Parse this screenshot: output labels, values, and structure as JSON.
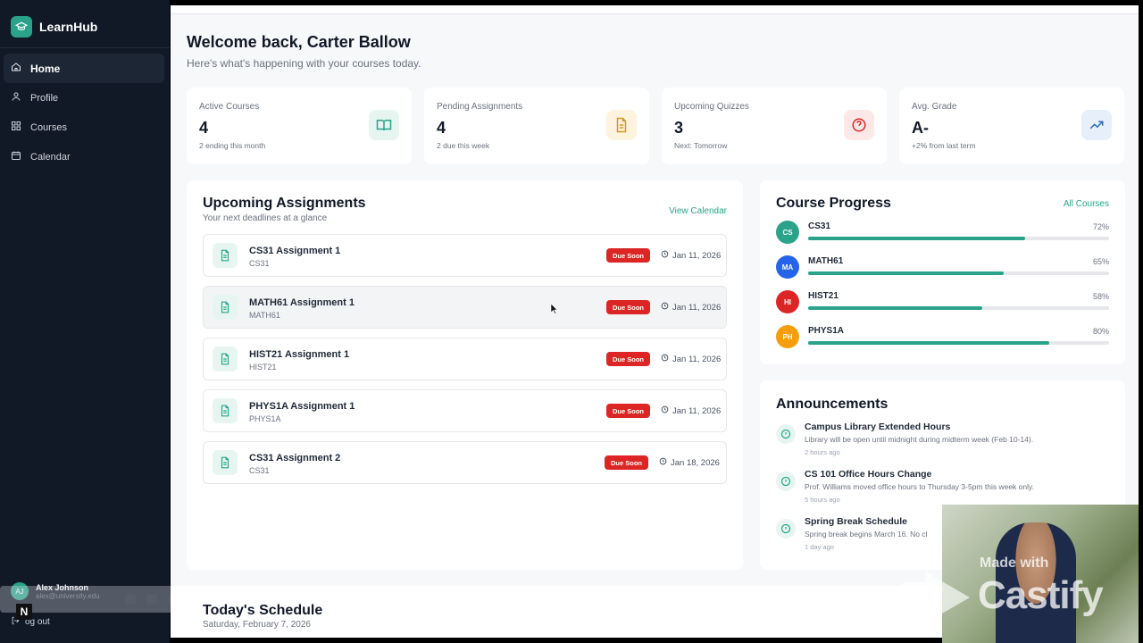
{
  "sidebar": {
    "brand": "LearnHub",
    "items": [
      {
        "label": "Home",
        "icon": "home-icon",
        "active": true
      },
      {
        "label": "Profile",
        "icon": "user-icon"
      },
      {
        "label": "Courses",
        "icon": "grid-icon"
      },
      {
        "label": "Calendar",
        "icon": "calendar-icon"
      }
    ],
    "user": {
      "initials": "AJ",
      "name": "Alex Johnson",
      "email": "alex@university.edu"
    },
    "logout_label": "Log out",
    "logout_visible_fragment": "og out"
  },
  "header": {
    "title": "Welcome back, Carter Ballow",
    "subtitle": "Here's what's happening with your courses today."
  },
  "stats": [
    {
      "label": "Active Courses",
      "value": "4",
      "note": "2 ending this month",
      "icon": "book-icon",
      "color": "#2aa38a",
      "bg": "#e7f5f1"
    },
    {
      "label": "Pending Assignments",
      "value": "4",
      "note": "2 due this week",
      "icon": "document-icon",
      "color": "#d59a22",
      "bg": "#fdf3df"
    },
    {
      "label": "Upcoming Quizzes",
      "value": "3",
      "note": "Next: Tomorrow",
      "icon": "question-icon",
      "color": "#dc2626",
      "bg": "#fde8e8"
    },
    {
      "label": "Avg. Grade",
      "value": "A-",
      "note": "+2% from last term",
      "icon": "trend-up-icon",
      "color": "#2b6cb0",
      "bg": "#e6effa"
    }
  ],
  "assignments": {
    "title": "Upcoming Assignments",
    "subtitle": "Your next deadlines at a glance",
    "link": "View Calendar",
    "items": [
      {
        "name": "CS31 Assignment 1",
        "course": "CS31",
        "badge": "Due Soon",
        "date": "Jan 11, 2026"
      },
      {
        "name": "MATH61 Assignment 1",
        "course": "MATH61",
        "badge": "Due Soon",
        "date": "Jan 11, 2026"
      },
      {
        "name": "HIST21 Assignment 1",
        "course": "HIST21",
        "badge": "Due Soon",
        "date": "Jan 11, 2026"
      },
      {
        "name": "PHYS1A Assignment 1",
        "course": "PHYS1A",
        "badge": "Due Soon",
        "date": "Jan 11, 2026"
      },
      {
        "name": "CS31 Assignment 2",
        "course": "CS31",
        "badge": "Due Soon",
        "date": "Jan 18, 2026"
      }
    ]
  },
  "progress": {
    "title": "Course Progress",
    "link": "All Courses",
    "items": [
      {
        "initials": "CS",
        "name": "CS31",
        "pct_label": "72%",
        "pct": 0.72,
        "color": "#2aa38a"
      },
      {
        "initials": "MA",
        "name": "MATH61",
        "pct_label": "65%",
        "pct": 0.65,
        "color": "#2563eb"
      },
      {
        "initials": "HI",
        "name": "HIST21",
        "pct_label": "58%",
        "pct": 0.58,
        "color": "#dc2626"
      },
      {
        "initials": "PH",
        "name": "PHYS1A",
        "pct_label": "80%",
        "pct": 0.8,
        "color": "#f59e0b"
      }
    ]
  },
  "announcements": {
    "title": "Announcements",
    "items": [
      {
        "title": "Campus Library Extended Hours",
        "body": "Library will be open until midnight during midterm week (Feb 10-14).",
        "time": "2 hours ago"
      },
      {
        "title": "CS 101 Office Hours Change",
        "body": "Prof. Williams moved office hours to Thursday 3-5pm this week only.",
        "time": "5 hours ago"
      },
      {
        "title": "Spring Break Schedule",
        "body": "Spring break begins March 16. No cl",
        "time": "1 day ago"
      }
    ]
  },
  "schedule": {
    "title": "Today's Schedule",
    "date": "Saturday, February 7, 2026"
  },
  "overlay": {
    "toolbar_badge": "N",
    "watermark_made": "Made with",
    "watermark_brand": "Castify"
  },
  "colors": {
    "accent": "#2aa38a",
    "sidebar_bg": "#111826",
    "danger": "#dc2626"
  }
}
